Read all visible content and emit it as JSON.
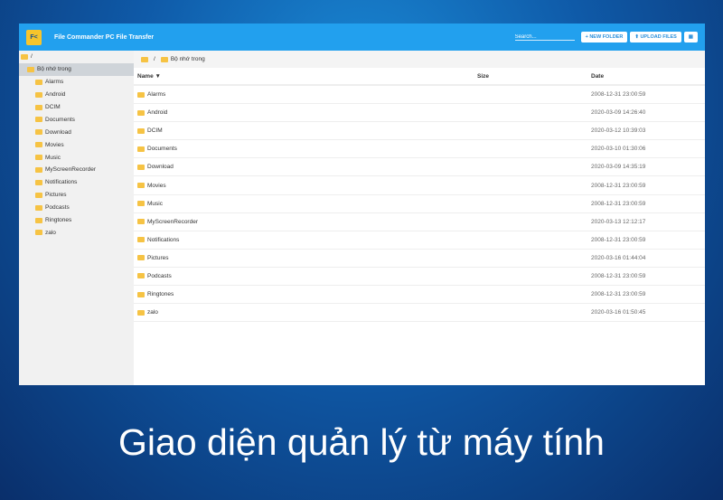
{
  "app": {
    "title": "File Commander PC File Transfer",
    "logo": "FC",
    "search_placeholder": "Search...",
    "new_folder": "+ NEW FOLDER",
    "upload": "⬆ UPLOAD FILES"
  },
  "sidebar": {
    "root": "/",
    "storage": "Bộ nhớ trong",
    "items": [
      "Alarms",
      "Android",
      "DCIM",
      "Documents",
      "Download",
      "Movies",
      "Music",
      "MyScreenRecorder",
      "Notifications",
      "Pictures",
      "Podcasts",
      "Ringtones",
      "zalo"
    ]
  },
  "breadcrumb": {
    "root": "/",
    "current": "Bộ nhớ trong"
  },
  "table": {
    "headers": {
      "name": "Name ▼",
      "size": "Size",
      "date": "Date"
    },
    "rows": [
      {
        "name": "Alarms",
        "date": "2008-12-31 23:00:59"
      },
      {
        "name": "Android",
        "date": "2020-03-09 14:26:40"
      },
      {
        "name": "DCIM",
        "date": "2020-03-12 10:39:03"
      },
      {
        "name": "Documents",
        "date": "2020-03-10 01:30:06"
      },
      {
        "name": "Download",
        "date": "2020-03-09 14:35:19"
      },
      {
        "name": "Movies",
        "date": "2008-12-31 23:00:59"
      },
      {
        "name": "Music",
        "date": "2008-12-31 23:00:59"
      },
      {
        "name": "MyScreenRecorder",
        "date": "2020-03-13 12:12:17"
      },
      {
        "name": "Notifications",
        "date": "2008-12-31 23:00:59"
      },
      {
        "name": "Pictures",
        "date": "2020-03-16 01:44:04"
      },
      {
        "name": "Podcasts",
        "date": "2008-12-31 23:00:59"
      },
      {
        "name": "Ringtones",
        "date": "2008-12-31 23:00:59"
      },
      {
        "name": "zalo",
        "date": "2020-03-16 01:50:45"
      }
    ]
  },
  "caption": "Giao diện quản lý từ máy tính"
}
